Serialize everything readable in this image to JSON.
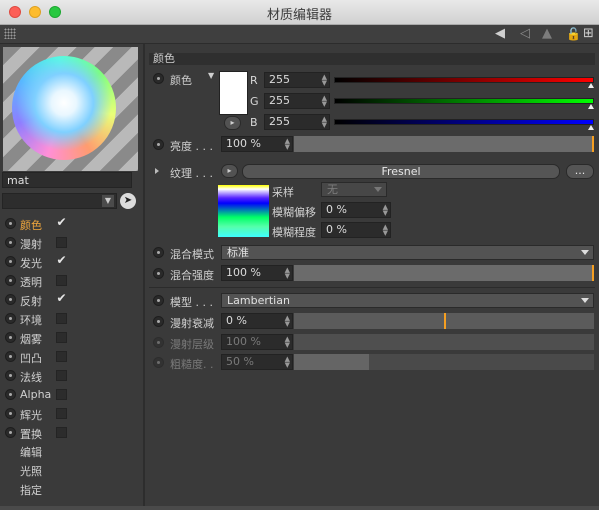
{
  "window": {
    "title": "材质编辑器"
  },
  "material": {
    "name": "mat",
    "link_value": ""
  },
  "channels": [
    {
      "label": "颜色",
      "checked": true,
      "active": true
    },
    {
      "label": "漫射",
      "checked": false,
      "active": false
    },
    {
      "label": "发光",
      "checked": true,
      "active": false
    },
    {
      "label": "透明",
      "checked": false,
      "active": false
    },
    {
      "label": "反射",
      "checked": true,
      "active": false
    },
    {
      "label": "环境",
      "checked": false,
      "active": false
    },
    {
      "label": "烟雾",
      "checked": false,
      "active": false
    },
    {
      "label": "凹凸",
      "checked": false,
      "active": false
    },
    {
      "label": "法线",
      "checked": false,
      "active": false
    },
    {
      "label": "Alpha",
      "checked": false,
      "active": false
    },
    {
      "label": "辉光",
      "checked": false,
      "active": false
    },
    {
      "label": "置换",
      "checked": false,
      "active": false
    }
  ],
  "extra_items": [
    "编辑",
    "光照",
    "指定"
  ],
  "checkmark": "✔",
  "section_title": "颜色",
  "color": {
    "label": "颜色",
    "swatch": "#ffffff",
    "r_label": "R",
    "r_value": "255",
    "g_label": "G",
    "g_value": "255",
    "b_label": "B",
    "b_value": "255"
  },
  "brightness": {
    "label": "亮度 . . .",
    "value": "100 %",
    "fraction": 1.0
  },
  "texture": {
    "label": "纹理 . . .",
    "shader": "Fresnel",
    "more": "...",
    "sampling_label": "采样",
    "sampling_value": "无",
    "blur_offset_label": "模糊偏移",
    "blur_offset_value": "0 %",
    "blur_scale_label": "模糊程度",
    "blur_scale_value": "0 %"
  },
  "blend_mode": {
    "label": "混合模式",
    "value": "标准"
  },
  "blend_strength": {
    "label": "混合强度",
    "value": "100 %",
    "fraction": 1.0
  },
  "model": {
    "label": "模型 . . .",
    "value": "Lambertian"
  },
  "diffuse_falloff": {
    "label": "漫射衰减",
    "value": "0 %",
    "fraction": 0.5
  },
  "diffuse_level": {
    "label": "漫射层级",
    "value": "100 %",
    "fraction": 1.0
  },
  "roughness": {
    "label": "粗糙度. .",
    "value": "50 %",
    "fraction": 0.25
  },
  "colors": {
    "accent": "#f3a83c",
    "panel": "#3a3a3a",
    "field": "#2b2b2b"
  }
}
